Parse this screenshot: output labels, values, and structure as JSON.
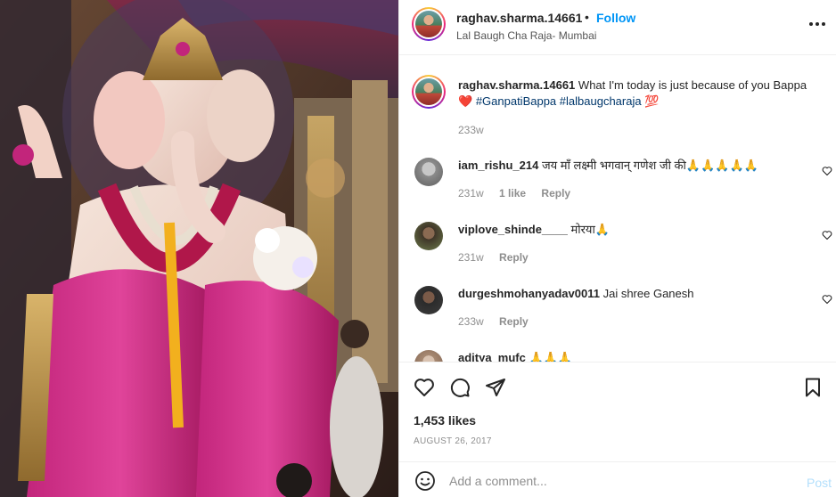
{
  "header": {
    "username": "raghav.sharma.14661",
    "separator": "•",
    "follow_label": "Follow",
    "location": "Lal Baugh Cha Raja- Mumbai",
    "more_icon": "more-horizontal-icon"
  },
  "caption": {
    "username": "raghav.sharma.14661",
    "text": "What I'm today is just because of you Bappa",
    "heart_emoji": "❤️",
    "hashtags": [
      "#GanpatiBappa",
      "#lalbaugcharaja"
    ],
    "end_emoji": "💯",
    "time": "233w"
  },
  "comments": [
    {
      "username": "iam_rishu_214",
      "text": "जय माँ लक्ष्मी भगवान् गणेश जी की🙏🙏🙏🙏🙏",
      "time": "231w",
      "likes": "1 like",
      "reply": "Reply"
    },
    {
      "username": "viplove_shinde____",
      "text": "मोरया🙏",
      "time": "231w",
      "likes": "",
      "reply": "Reply"
    },
    {
      "username": "durgeshmohanyadav0011",
      "text": "Jai shree Ganesh",
      "time": "233w",
      "likes": "",
      "reply": "Reply"
    },
    {
      "username": "aditya_mufc",
      "text": "🙏🙏🙏",
      "time": "",
      "likes": "",
      "reply": ""
    }
  ],
  "actions": {
    "like_icon": "heart-outline-icon",
    "comment_icon": "comment-bubble-icon",
    "share_icon": "paper-plane-icon",
    "save_icon": "bookmark-icon"
  },
  "likes_text": "1,453 likes",
  "date_text": "AUGUST 26, 2017",
  "add_comment": {
    "placeholder": "Add a comment...",
    "post_label": "Post",
    "emoji_icon": "smiley-icon"
  },
  "colors": {
    "accent": "#0095f6",
    "post_disabled": "#b2dffc",
    "hashtag": "#00376b",
    "muted": "#8e8e8e"
  }
}
